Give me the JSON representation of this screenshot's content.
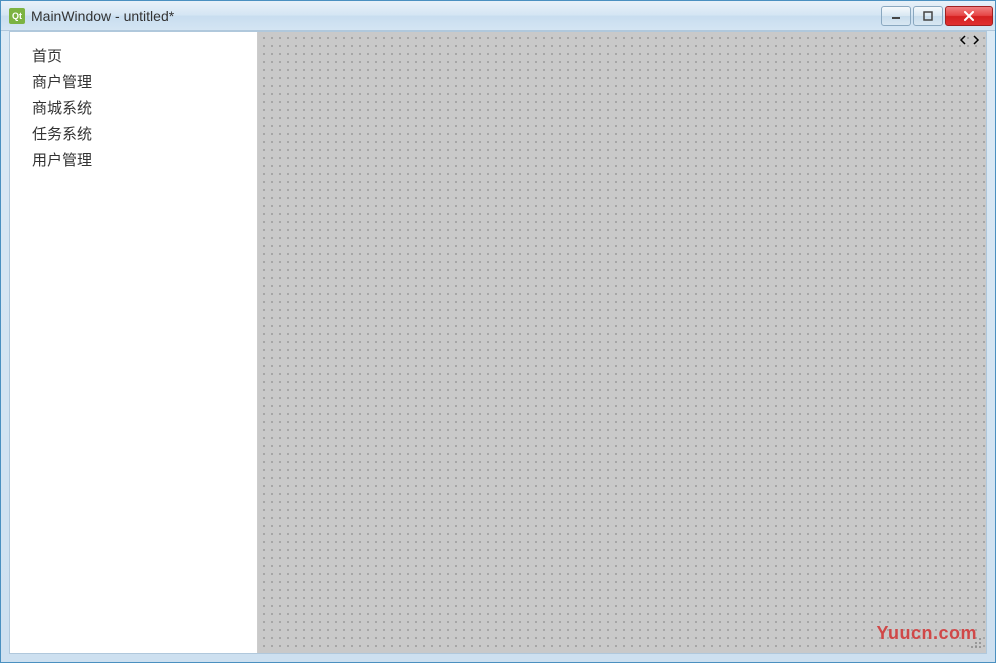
{
  "window": {
    "title": "MainWindow - untitled*",
    "app_icon_text": "Qt"
  },
  "sidebar": {
    "items": [
      {
        "label": "首页"
      },
      {
        "label": "商户管理"
      },
      {
        "label": "商城系统"
      },
      {
        "label": "任务系统"
      },
      {
        "label": "用户管理"
      }
    ]
  },
  "watermark": "Yuucn.com"
}
